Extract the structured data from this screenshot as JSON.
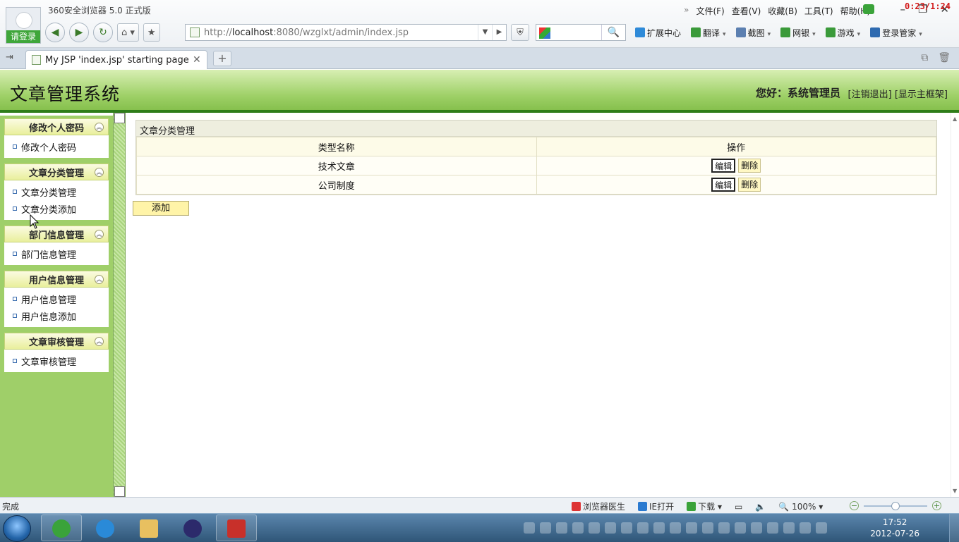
{
  "browser": {
    "app_title": "360安全浏览器 5.0 正式版",
    "login_label": "请登录",
    "menus": [
      "文件(F)",
      "查看(V)",
      "收藏(B)",
      "工具(T)",
      "帮助(H)"
    ],
    "timer": "0:23/1:24",
    "url_prefix": "http://",
    "url_host": "localhost",
    "url_rest": ":8080/wzglxt/admin/index.jsp",
    "tools": [
      {
        "label": "扩展中心",
        "icon": "extension-icon",
        "color": "#2e8ad8"
      },
      {
        "label": "翻译",
        "icon": "translate-icon",
        "color": "#3a9a3a"
      },
      {
        "label": "截图",
        "icon": "screenshot-icon",
        "color": "#5b7fb0"
      },
      {
        "label": "网银",
        "icon": "ebank-icon",
        "color": "#3a9a3a"
      },
      {
        "label": "游戏",
        "icon": "game-icon",
        "color": "#3a9a3a"
      },
      {
        "label": "登录管家",
        "icon": "key-icon",
        "color": "#2e6ab0"
      }
    ],
    "tab_label": "My JSP 'index.jsp' starting page"
  },
  "header": {
    "system_title": "文章管理系统",
    "greeting": "您好：系统管理员",
    "logout": "[注销退出]",
    "show_frame": "[显示主框架]"
  },
  "sidebar": {
    "groups": [
      {
        "title": "修改个人密码",
        "items": [
          "修改个人密码"
        ]
      },
      {
        "title": "文章分类管理",
        "items": [
          "文章分类管理",
          "文章分类添加"
        ]
      },
      {
        "title": "部门信息管理",
        "items": [
          "部门信息管理"
        ]
      },
      {
        "title": "用户信息管理",
        "items": [
          "用户信息管理",
          "用户信息添加"
        ]
      },
      {
        "title": "文章审核管理",
        "items": [
          "文章审核管理"
        ]
      }
    ]
  },
  "main": {
    "panel_title": "文章分类管理",
    "columns": [
      "类型名称",
      "操作"
    ],
    "rows": [
      {
        "name": "技术文章",
        "edit": "编辑",
        "delete": "删除"
      },
      {
        "name": "公司制度",
        "edit": "编辑",
        "delete": "删除"
      }
    ],
    "add_label": "添加"
  },
  "statusbar": {
    "done": "完成",
    "doctor": "浏览器医生",
    "ie_open": "IE打开",
    "download": "下载",
    "zoom": "100%",
    "zoom_level": 0.5
  },
  "taskbar": {
    "time": "17:52",
    "date": "2012-07-26"
  }
}
